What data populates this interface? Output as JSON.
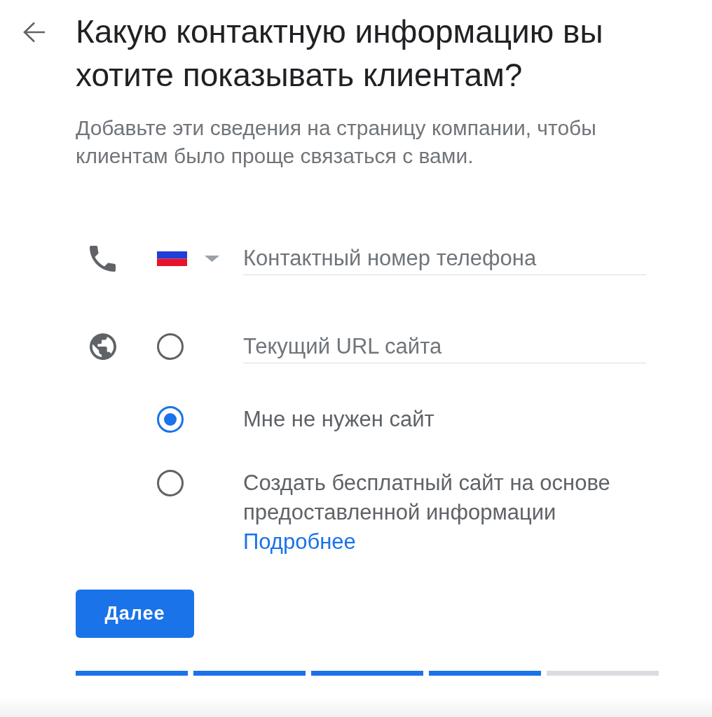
{
  "title": "Какую контактную информацию вы хотите показывать клиентам?",
  "subtitle": "Добавьте эти сведения на страницу компании, чтобы клиентам было проще связаться с вами.",
  "phone": {
    "placeholder": "Контактный номер телефона"
  },
  "website": {
    "options": [
      {
        "kind": "url_field",
        "placeholder": "Текущий URL сайта",
        "selected": false
      },
      {
        "kind": "label",
        "label": "Мне не нужен сайт",
        "selected": true
      },
      {
        "kind": "label",
        "label": "Создать бесплатный сайт на основе предоставленной информации",
        "link": "Подробнее",
        "selected": false
      }
    ]
  },
  "next_button": {
    "label": "Далее"
  },
  "progress": {
    "steps": [
      {
        "completed": true
      },
      {
        "completed": true
      },
      {
        "completed": true
      },
      {
        "completed": true
      },
      {
        "completed": false
      }
    ]
  }
}
